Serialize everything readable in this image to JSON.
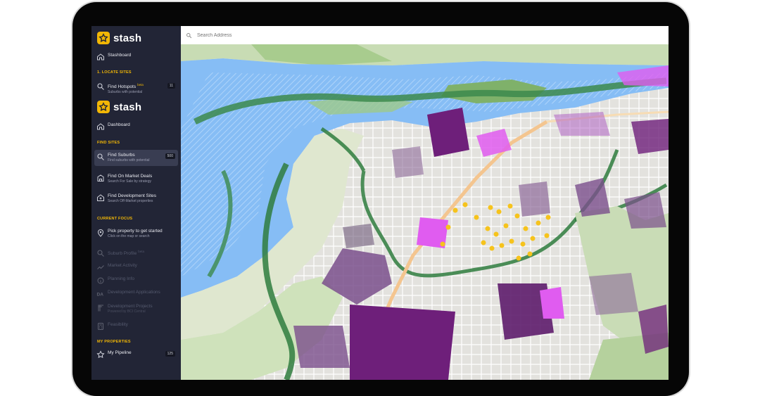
{
  "app": {
    "brand": "stash"
  },
  "sidebar_back": {
    "items": [
      {
        "label": "Stashboard",
        "icon": "home-icon"
      },
      {
        "label": "Find Hotspots",
        "beta": "beta",
        "sub": "Suburbs with potential",
        "count": "11",
        "icon": "search-icon"
      }
    ],
    "section": "1. LOCATE SITES"
  },
  "sidebar": {
    "dashboard": "Dashboard",
    "find_sites": {
      "heading": "FIND SITES",
      "items": [
        {
          "label": "Find Suburbs",
          "sub": "Find suburbs with potential",
          "count": "500",
          "icon": "search-icon"
        },
        {
          "label": "Find On Market Deals",
          "sub": "Search For Sale by strategy",
          "icon": "building-icon"
        },
        {
          "label": "Find Development Sites",
          "sub": "Search Off-Market properties",
          "icon": "home-plus-icon"
        }
      ]
    },
    "current_focus": {
      "heading": "CURRENT FOCUS",
      "items": [
        {
          "label": "Pick property to get started",
          "sub": "Click on the map or search",
          "icon": "map-pin-icon"
        },
        {
          "label": "Suburb Profile",
          "beta": "beta",
          "icon": "search-icon"
        },
        {
          "label": "Market Activity",
          "icon": "chart-icon"
        },
        {
          "label": "Planning Info",
          "icon": "info-icon"
        },
        {
          "label": "Development Applications",
          "icon": "da-icon"
        },
        {
          "label": "Development Projects",
          "sub": "Powered by BCI Central",
          "icon": "crane-icon"
        },
        {
          "label": "Feasibility",
          "icon": "calculator-icon"
        }
      ]
    },
    "my_properties": {
      "heading": "MY PROPERTIES",
      "items": [
        {
          "label": "My Pipeline",
          "count": "125",
          "icon": "star-icon"
        }
      ]
    }
  },
  "search": {
    "placeholder": "Search Address"
  },
  "colors": {
    "sidebar_bg": "#222536",
    "accent": "#f2b705",
    "water": "#86bdf5",
    "park": "#6aa05b",
    "overlay_purple": "#6b2a7a",
    "overlay_magenta": "#e05cf0"
  }
}
